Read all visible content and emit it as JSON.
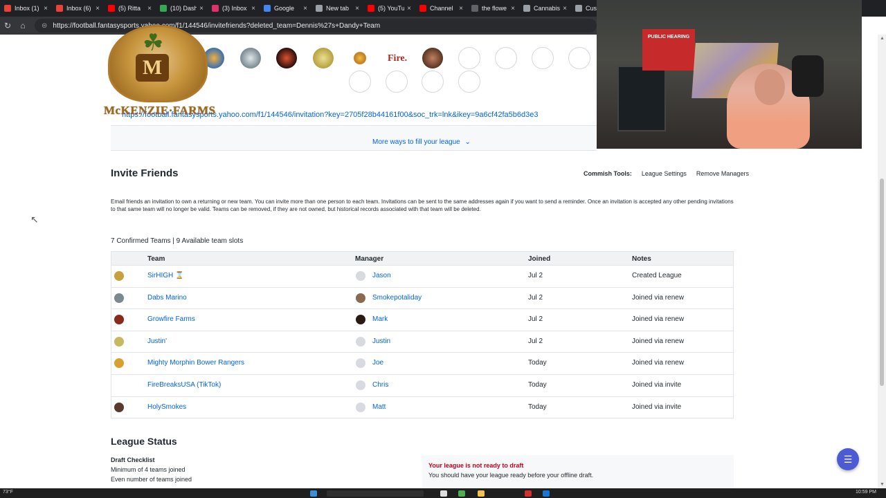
{
  "browser": {
    "tabs": [
      {
        "label": "Inbox (1)",
        "color": "#ea4335"
      },
      {
        "label": "Inbox (6)",
        "color": "#ea4335"
      },
      {
        "label": "(5) Ritta",
        "color": "#ff0000"
      },
      {
        "label": "(10) Dash",
        "color": "#34a853"
      },
      {
        "label": "(3) Inbox",
        "color": "#e1306c"
      },
      {
        "label": "Google",
        "color": "#4285f4"
      },
      {
        "label": "New tab",
        "color": "#9aa0a6"
      },
      {
        "label": "(5) YouTu",
        "color": "#ff0000"
      },
      {
        "label": "Channel",
        "color": "#ff0000"
      },
      {
        "label": "the flowe",
        "color": "#5f6368"
      },
      {
        "label": "Cannabis",
        "color": "#9aa0a6"
      },
      {
        "label": "Cus",
        "color": "#9aa0a6"
      }
    ],
    "url": "https://football.fantasysports.yahoo.com/f1/144546/invitefriends?deleted_team=Dennis%27s+Dandy+Team"
  },
  "invite": {
    "link": "https://football.fantasysports.yahoo.com/f1/144546/invitation?key=2705f28b44161f00&soc_trk=lnk&ikey=9a6cf42fa5b6d3e3",
    "more_ways": "More ways to fill your league",
    "fire_logo_text": "Fire."
  },
  "section": {
    "title": "Invite Friends",
    "commish_label": "Commish Tools:",
    "league_settings": "League Settings",
    "remove_managers": "Remove Managers",
    "description": "Email friends an invitation to own a returning or new team. You can invite more than one person to each team. Invitations can be sent to the same addresses again if you want to send a reminder. Once an invitation is accepted any other pending invitations to that same team will no longer be valid. Teams can be removed, if they are not owned, but historical records associated with that team will be deleted.",
    "counts": "7 Confirmed Teams | 9 Available team slots"
  },
  "table": {
    "headers": {
      "team": "Team",
      "manager": "Manager",
      "joined": "Joined",
      "notes": "Notes"
    },
    "rows": [
      {
        "team": "SirHIGH ⌛",
        "manager": "Jason",
        "joined": "Jul 2",
        "notes": "Created League",
        "logo": "#c8a040",
        "avatar": "#d8dadf"
      },
      {
        "team": "Dabs Marino",
        "manager": "Smokepotaliday",
        "joined": "Jul 2",
        "notes": "Joined via renew",
        "logo": "#7a8a90",
        "avatar": "#8a6a50"
      },
      {
        "team": "Growfire Farms",
        "manager": "Mark",
        "joined": "Jul 2",
        "notes": "Joined via renew",
        "logo": "#8a2a1a",
        "avatar": "#2a1a14"
      },
      {
        "team": "Justin'",
        "manager": "Justin",
        "joined": "Jul 2",
        "notes": "Joined via renew",
        "logo": "#c9b860",
        "avatar": "#d8dadf"
      },
      {
        "team": "Mighty Morphin Bower Rangers",
        "manager": "Joe",
        "joined": "Today",
        "notes": "Joined via renew",
        "logo": "#d8a030",
        "avatar": "#d8dadf"
      },
      {
        "team": "FireBreaksUSA (TikTok)",
        "manager": "Chris",
        "joined": "Today",
        "notes": "Joined via invite",
        "logo": "#ffffff",
        "avatar": "#d8dadf"
      },
      {
        "team": "HolySmokes",
        "manager": "Matt",
        "joined": "Today",
        "notes": "Joined via invite",
        "logo": "#5a3a2a",
        "avatar": "#d8dadf"
      }
    ]
  },
  "league_status": {
    "title": "League Status",
    "draft_checklist": "Draft Checklist",
    "items": [
      "Minimum of 4 teams joined",
      "Even number of teams joined"
    ],
    "not_ready_title": "Your league is not ready to draft",
    "not_ready_sub": "You should have your league ready before your offline draft."
  },
  "overlay": {
    "brand_text": "McKENZIE·FARMS",
    "sign_text": "PUBLIC HEARING"
  },
  "taskbar": {
    "time": "10:59 PM",
    "temp": "73°F"
  },
  "colors": {
    "link": "#0063eb",
    "error": "#c7001b",
    "chat": "#4c5bd4"
  }
}
